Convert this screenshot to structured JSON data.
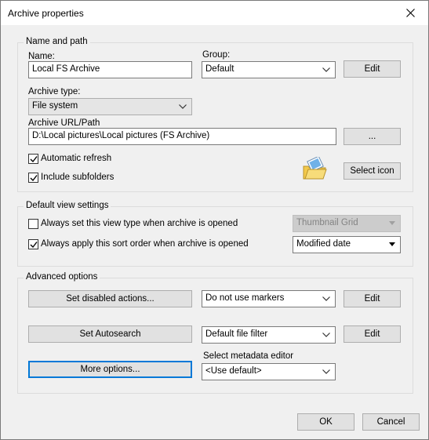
{
  "dialog": {
    "title": "Archive properties"
  },
  "name_and_path": {
    "legend": "Name and path",
    "name_label": "Name:",
    "name_value": "Local FS Archive",
    "group_label": "Group:",
    "group_value": "Default",
    "group_edit": "Edit",
    "archive_type_label": "Archive type:",
    "archive_type_value": "File system",
    "url_label": "Archive URL/Path",
    "url_value": "D:\\Local pictures\\Local pictures (FS Archive)",
    "browse_label": "...",
    "automatic_refresh_label": "Automatic refresh",
    "automatic_refresh_checked": true,
    "include_subfolders_label": "Include subfolders",
    "include_subfolders_checked": true,
    "select_icon_label": "Select icon"
  },
  "default_view": {
    "legend": "Default view settings",
    "view_type_label": "Always set this view type when archive is opened",
    "view_type_checked": false,
    "view_type_value": "Thumbnail Grid",
    "sort_order_label": "Always apply this sort order when archive is opened",
    "sort_order_checked": true,
    "sort_order_value": "Modified date"
  },
  "advanced": {
    "legend": "Advanced options",
    "disabled_actions_label": "Set disabled actions...",
    "markers_value": "Do not use markers",
    "markers_edit": "Edit",
    "autosearch_label": "Set Autosearch",
    "file_filter_value": "Default file filter",
    "file_filter_edit": "Edit",
    "more_options_label": "More options...",
    "metadata_editor_label": "Select metadata editor",
    "metadata_editor_value": "<Use default>"
  },
  "footer": {
    "ok_label": "OK",
    "cancel_label": "Cancel"
  },
  "icons": {
    "close": "close-icon",
    "dropdown": "chevron-down-icon",
    "check": "checkmark-icon",
    "archive": "folder-picture-icon"
  }
}
